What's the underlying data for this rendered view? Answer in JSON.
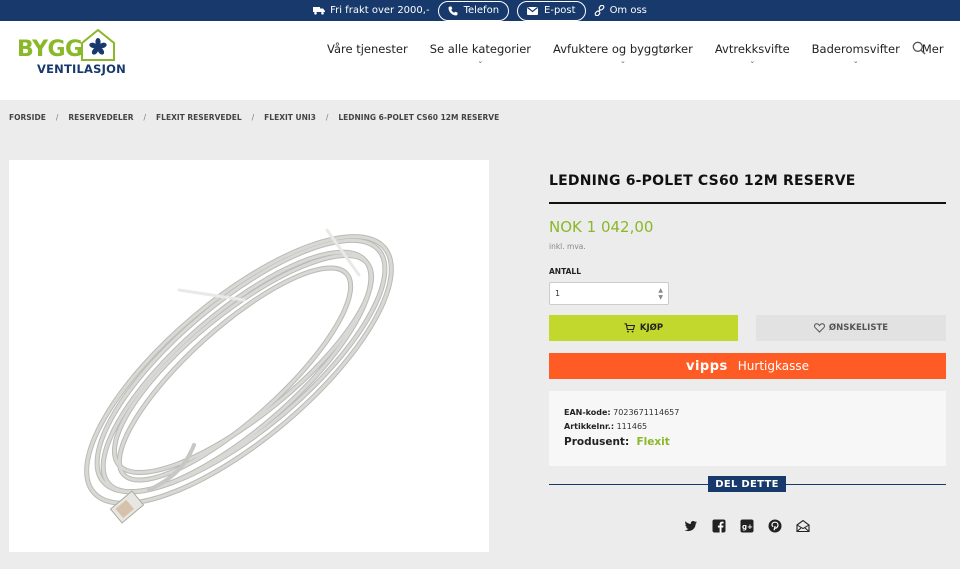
{
  "topbar": {
    "shipping_text": "Fri frakt over 2000,-",
    "phone_label": "Telefon",
    "email_label": "E-post",
    "about_label": "Om oss"
  },
  "logo": {
    "line1": "BYGG",
    "line2": "VENTILASJON"
  },
  "nav": {
    "items": [
      {
        "label": "Våre tjenester"
      },
      {
        "label": "Se alle kategorier"
      },
      {
        "label": "Avfuktere og byggtørker"
      },
      {
        "label": "Avtrekksvifte"
      },
      {
        "label": "Baderomsvifter"
      },
      {
        "label": "Mer"
      }
    ]
  },
  "breadcrumb": {
    "items": [
      "FORSIDE",
      "RESERVEDELER",
      "FLEXIT RESERVEDEL",
      "FLEXIT UNI3",
      "LEDNING 6-POLET CS60 12M RESERVE"
    ],
    "separator": "/"
  },
  "product": {
    "title": "LEDNING 6-POLET CS60 12M RESERVE",
    "price": "NOK 1 042,00",
    "vat_note": "inkl. mva.",
    "quantity_label": "ANTALL",
    "quantity_value": "1",
    "buy_label": "KJØP",
    "wishlist_label": "ØNSKELISTE",
    "vipps_brand": "vipps",
    "vipps_label": "Hurtigkasse",
    "ean_label": "EAN-kode:",
    "ean_value": "7023671114657",
    "sku_label": "Artikkelnr.:",
    "sku_value": "111465",
    "manufacturer_label": "Produsent:",
    "manufacturer_value": "Flexit"
  },
  "share": {
    "label": "DEL DETTE",
    "icons": [
      "twitter-icon",
      "facebook-icon",
      "google-plus-icon",
      "pinterest-icon",
      "email-icon"
    ]
  },
  "colors": {
    "topbar": "#17396b",
    "accent_green": "#8ab828",
    "buy_button": "#c3d82c",
    "vipps_orange": "#ff5b24"
  }
}
